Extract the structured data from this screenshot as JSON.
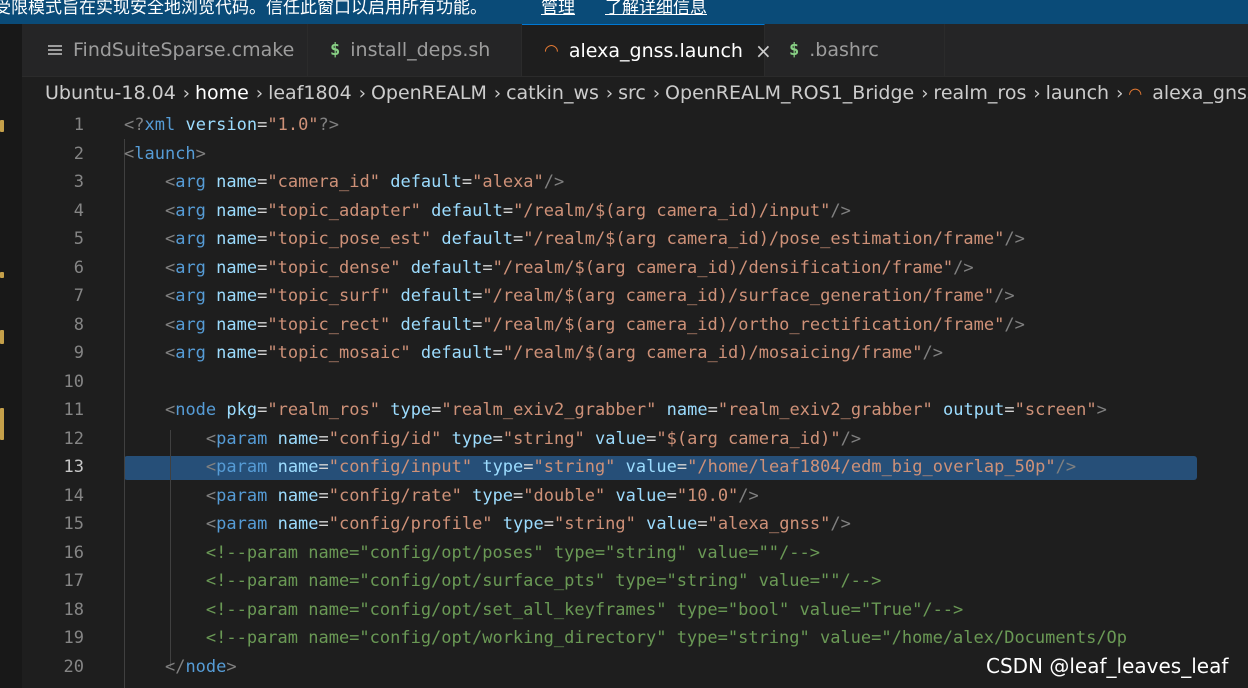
{
  "banner": {
    "message": "受限模式旨在实现安全地浏览代码。信任此窗口以启用所有功能。",
    "manage_link": "管理",
    "details_link": "了解详细信息"
  },
  "tabs": [
    {
      "label": "FindSuiteSparse.cmake",
      "icon": "cmake-file-icon",
      "active": false
    },
    {
      "label": "install_deps.sh",
      "icon": "shell-dollar-icon",
      "active": false
    },
    {
      "label": "alexa_gnss.launch",
      "icon": "rss-launch-icon",
      "active": true,
      "close": "×"
    },
    {
      "label": ".bashrc",
      "icon": "shell-dollar-icon",
      "active": false
    }
  ],
  "breadcrumb": [
    "Ubuntu-18.04",
    "home",
    "leaf1804",
    "OpenREALM",
    "catkin_ws",
    "src",
    "OpenREALM_ROS1_Bridge",
    "realm_ros",
    "launch",
    "alexa_gnss.launch"
  ],
  "editor": {
    "current_line": 13,
    "line_numbers": [
      "1",
      "2",
      "3",
      "4",
      "5",
      "6",
      "7",
      "8",
      "9",
      "10",
      "11",
      "12",
      "13",
      "14",
      "15",
      "16",
      "17",
      "18",
      "19",
      "20"
    ],
    "lines": [
      "<?xml version=\"1.0\"?>",
      "<launch>",
      "    <arg name=\"camera_id\" default=\"alexa\"/>",
      "    <arg name=\"topic_adapter\" default=\"/realm/$(arg camera_id)/input\"/>",
      "    <arg name=\"topic_pose_est\" default=\"/realm/$(arg camera_id)/pose_estimation/frame\"/>",
      "    <arg name=\"topic_dense\" default=\"/realm/$(arg camera_id)/densification/frame\"/>",
      "    <arg name=\"topic_surf\" default=\"/realm/$(arg camera_id)/surface_generation/frame\"/>",
      "    <arg name=\"topic_rect\" default=\"/realm/$(arg camera_id)/ortho_rectification/frame\"/>",
      "    <arg name=\"topic_mosaic\" default=\"/realm/$(arg camera_id)/mosaicing/frame\"/>",
      "",
      "    <node pkg=\"realm_ros\" type=\"realm_exiv2_grabber\" name=\"realm_exiv2_grabber\" output=\"screen\">",
      "        <param name=\"config/id\" type=\"string\" value=\"$(arg camera_id)\"/>",
      "        <param name=\"config/input\" type=\"string\" value=\"/home/leaf1804/edm_big_overlap_50p\"/>",
      "        <param name=\"config/rate\" type=\"double\" value=\"10.0\"/>",
      "        <param name=\"config/profile\" type=\"string\" value=\"alexa_gnss\"/>",
      "        <!--param name=\"config/opt/poses\" type=\"string\" value=\"\"/-->",
      "        <!--param name=\"config/opt/surface_pts\" type=\"string\" value=\"\"/-->",
      "        <!--param name=\"config/opt/set_all_keyframes\" type=\"bool\" value=\"True\"/-->",
      "        <!--param name=\"config/opt/working_directory\" type=\"string\" value=\"/home/alex/Documents/Op",
      "    </node>"
    ]
  },
  "watermark": "CSDN @leaf_leaves_leaf",
  "colors": {
    "banner": "#0a4b78",
    "editor_bg": "#1e1e1e",
    "tag_name": "#569cd6",
    "attribute": "#9cdcfe",
    "string": "#ce9178",
    "comment": "#6a9955",
    "selection": "#264f78",
    "launch_icon": "#e37933",
    "shell_icon": "#89d185"
  }
}
